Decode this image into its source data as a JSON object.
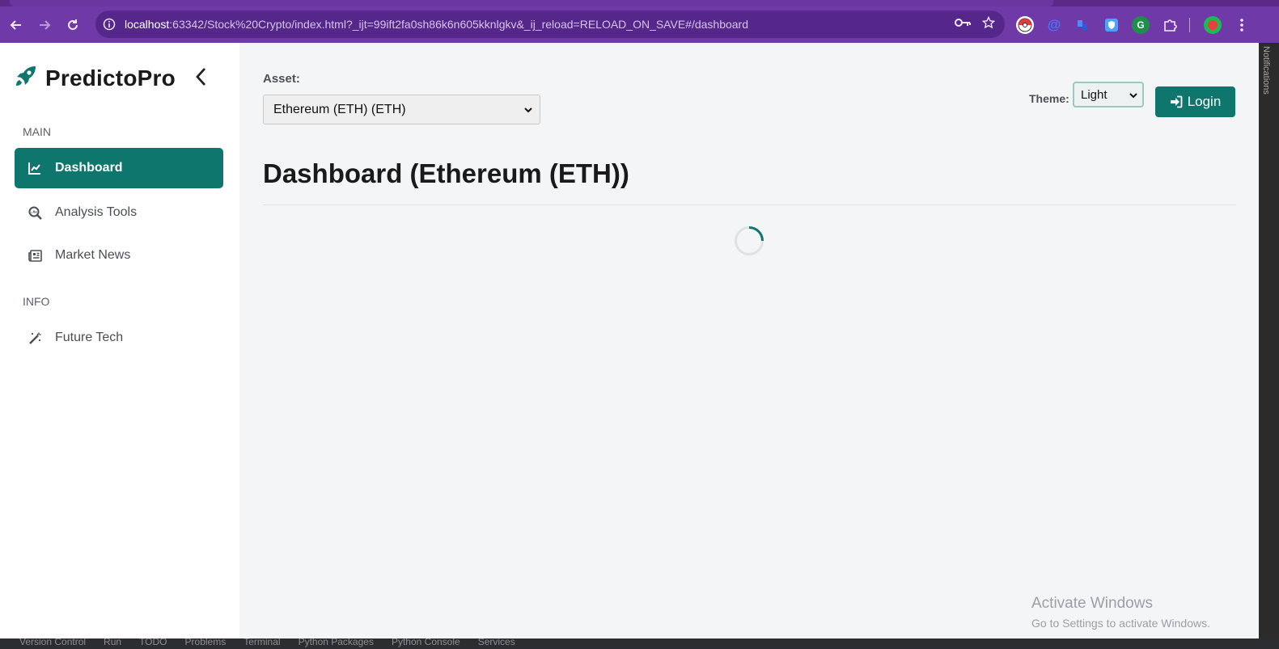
{
  "browser": {
    "url_host": "localhost",
    "url_rest": ":63342/Stock%20Crypto/index.html?_ijt=99ift2fa0sh86k6n605kknlgkv&_ij_reload=RELOAD_ON_SAVE#/dashboard"
  },
  "brand": {
    "name": "PredictoPro"
  },
  "sidebar": {
    "sections": [
      {
        "label": "MAIN"
      },
      {
        "label": "INFO"
      }
    ],
    "items": [
      {
        "label": "Dashboard",
        "icon": "chart-line-icon",
        "active": true
      },
      {
        "label": "Analysis Tools",
        "icon": "search-chart-icon"
      },
      {
        "label": "Market News",
        "icon": "newspaper-icon"
      },
      {
        "label": "Future Tech",
        "icon": "magic-wand-icon"
      }
    ]
  },
  "header": {
    "asset_label": "Asset:",
    "asset_value": "Ethereum (ETH) (ETH)",
    "theme_label": "Theme:",
    "theme_value": "Light",
    "login_label": "Login"
  },
  "main": {
    "title": "Dashboard (Ethereum (ETH))"
  },
  "colors": {
    "accent": "#0f766e",
    "browser_chrome": "#6f3aa8"
  },
  "watermark": {
    "title": "Activate Windows",
    "subtitle": "Go to Settings to activate Windows."
  },
  "side_panel": {
    "label": "Notifications"
  },
  "ide_bar": {
    "items": [
      "Version Control",
      "Run",
      "TODO",
      "Problems",
      "Terminal",
      "Python Packages",
      "Python Console",
      "Services"
    ]
  }
}
